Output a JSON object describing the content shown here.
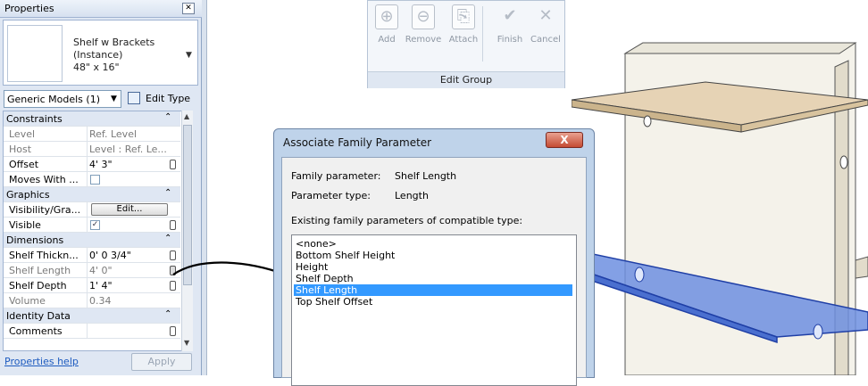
{
  "properties": {
    "title": "Properties",
    "close_glyph": "✕",
    "type_name_1": "Shelf w Brackets",
    "type_name_2": "(Instance)",
    "type_name_3": "48\" x 16\"",
    "type_dropdown_arrow": "▼",
    "filter_value": "Generic Models (1)",
    "filter_arrow": "▼",
    "edit_type_label": "Edit Type",
    "groups": {
      "constraints": "Constraints",
      "graphics": "Graphics",
      "dimensions": "Dimensions",
      "identity": "Identity Data"
    },
    "collapse_glyph": "⌃",
    "rows": {
      "level": {
        "label": "Level",
        "value": "Ref. Level"
      },
      "host": {
        "label": "Host",
        "value": "Level : Ref. Le..."
      },
      "offset": {
        "label": "Offset",
        "value": "4'  3\""
      },
      "moves_with": {
        "label": "Moves With ...",
        "value": ""
      },
      "visibility": {
        "label": "Visibility/Gra...",
        "button": "Edit..."
      },
      "visible": {
        "label": "Visible",
        "check": "✓"
      },
      "shelf_thickness": {
        "label": "Shelf Thickn...",
        "value": "0'  0 3/4\""
      },
      "shelf_length": {
        "label": "Shelf Length",
        "value": "4'  0\""
      },
      "shelf_depth": {
        "label": "Shelf Depth",
        "value": "1'  4\""
      },
      "volume": {
        "label": "Volume",
        "value": "0.34"
      },
      "comments": {
        "label": "Comments",
        "value": ""
      }
    },
    "help_link": "Properties help",
    "apply_label": "Apply",
    "scroll_up": "▲",
    "scroll_down": "▼"
  },
  "edit_group": {
    "tools": [
      {
        "label": "Add",
        "icon": "add-to-group-icon",
        "glyph": "⊕"
      },
      {
        "label": "Remove",
        "icon": "remove-from-group-icon",
        "glyph": "⊖"
      },
      {
        "label": "Attach",
        "icon": "attach-detail-icon",
        "glyph": "⎘"
      },
      {
        "label": "Finish",
        "icon": "checkmark-icon",
        "glyph": "✔"
      },
      {
        "label": "Cancel",
        "icon": "cancel-x-icon",
        "glyph": "✕"
      }
    ],
    "footer": "Edit Group"
  },
  "dialog": {
    "title": "Associate Family Parameter",
    "close_glyph": "X",
    "family_parameter_label": "Family parameter:",
    "family_parameter_value": "Shelf Length",
    "parameter_type_label": "Parameter type:",
    "parameter_type_value": "Length",
    "list_caption": "Existing family parameters of compatible type:",
    "list_items": [
      "<none>",
      "Bottom Shelf Height",
      "Height",
      "Shelf Depth",
      "Shelf Length",
      "Top Shelf Offset"
    ],
    "selected_index": 4
  },
  "colors": {
    "selection": "#3399ff",
    "palette_bg": "#dfe7f3",
    "shelf_wood": "#e6d3b5",
    "selected_shelf": "#4a78d8",
    "wall": "#f2efe4"
  }
}
